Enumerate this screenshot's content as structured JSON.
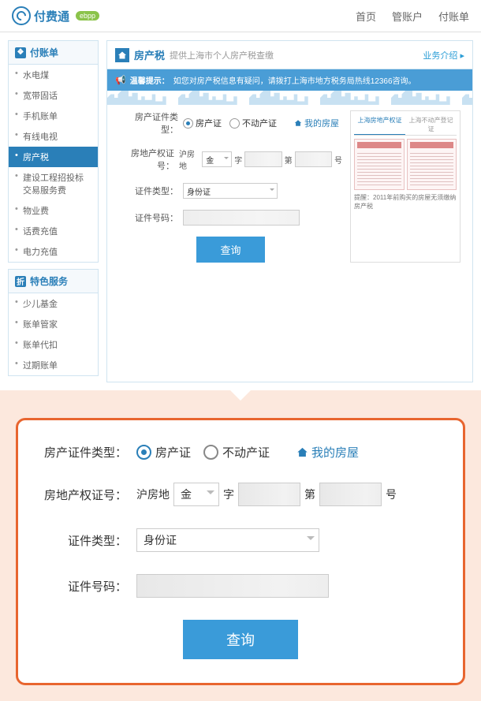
{
  "header": {
    "logo_text": "付费通",
    "logo_badge": "ebpp",
    "nav": [
      "首页",
      "管账户",
      "付账单"
    ]
  },
  "sidebar": {
    "group1": {
      "title": "付账单",
      "items": [
        "水电煤",
        "宽带固话",
        "手机账单",
        "有线电视",
        "房产税",
        "建设工程招投标交易服务费",
        "物业费",
        "话费充值",
        "电力充值"
      ],
      "active_index": 4
    },
    "group2": {
      "title": "特色服务",
      "items": [
        "少儿基金",
        "账单管家",
        "账单代扣",
        "过期账单"
      ]
    }
  },
  "main": {
    "title": "房产税",
    "subtitle": "提供上海市个人房产税查缴",
    "intro_link": "业务介绍",
    "banner_label": "温馨提示：",
    "banner_text": "如您对房产税信息有疑问，请拨打上海市地方税务局热线12366咨询。"
  },
  "form": {
    "label_doc_type": "房产证件类型：",
    "radio_opt1": "房产证",
    "radio_opt2": "不动产证",
    "my_house": "我的房屋",
    "label_cert_no": "房地产权证号：",
    "cert_prefix": "沪房地",
    "cert_sel": "金",
    "cert_zi": "字",
    "cert_di": "第",
    "cert_hao": "号",
    "label_id_type": "证件类型：",
    "id_type_value": "身份证",
    "label_id_no": "证件号码：",
    "query_button": "查询"
  },
  "sample": {
    "tab1": "上海房地产权证",
    "tab2": "上海不动产登记证",
    "note": "提醒：2011年前购买的房屋无须缴纳房产税"
  },
  "callout": {
    "label_doc_type": "房产证件类型：",
    "radio_opt1": "房产证",
    "radio_opt2": "不动产证",
    "my_house": "我的房屋",
    "label_cert_no": "房地产权证号：",
    "cert_prefix": "沪房地",
    "cert_sel": "金",
    "cert_zi": "字",
    "cert_di": "第",
    "cert_hao": "号",
    "label_id_type": "证件类型：",
    "id_type_value": "身份证",
    "label_id_no": "证件号码：",
    "query_button": "查询"
  }
}
